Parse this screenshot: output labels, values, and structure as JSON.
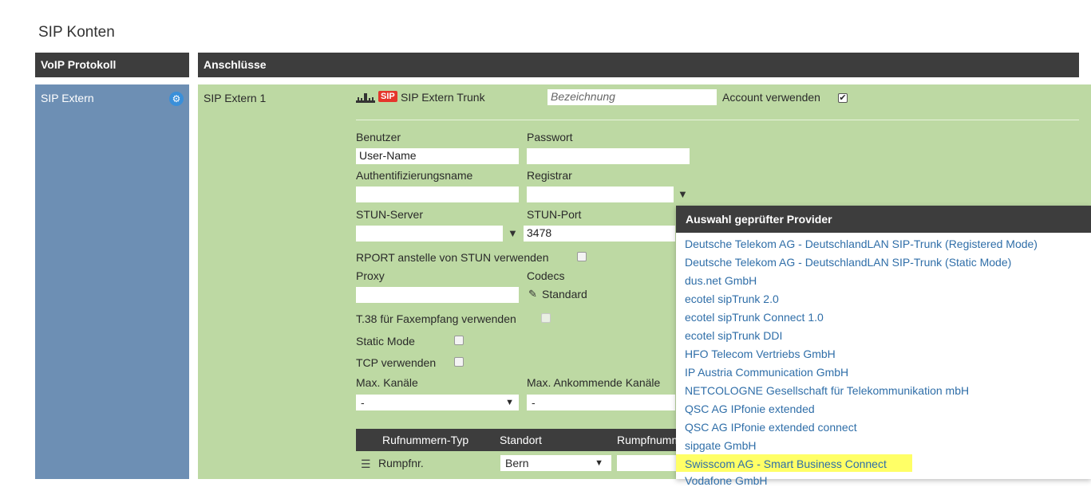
{
  "page_title": "SIP Konten",
  "headers": {
    "left": "VoIP Protokoll",
    "right": "Anschlüsse"
  },
  "left_item": "SIP Extern",
  "connection_name": "SIP Extern 1",
  "trunk": {
    "badge": "SIP",
    "title": "SIP Extern Trunk",
    "bezeichnung_placeholder": "Bezeichnung",
    "account_label": "Account verwenden",
    "account_checked": "✔"
  },
  "form": {
    "benutzer_label": "Benutzer",
    "benutzer_value": "User-Name",
    "passwort_label": "Passwort",
    "auth_label": "Authentifizierungsname",
    "registrar_label": "Registrar",
    "stun_server_label": "STUN-Server",
    "stun_port_label": "STUN-Port",
    "stun_port_value": "3478",
    "rport_label": "RPORT anstelle von STUN verwenden",
    "proxy_label": "Proxy",
    "codecs_label": "Codecs",
    "codecs_value": "Standard",
    "t38_label": "T.38 für Faxempfang verwenden",
    "static_label": "Static Mode",
    "tcp_label": "TCP verwenden",
    "max_kanaele_label": "Max. Kanäle",
    "max_kanaele_value": "-",
    "max_ankommende_label": "Max. Ankommende Kanäle",
    "max_ankommende_value": "-"
  },
  "table": {
    "col1": "Rufnummern-Typ",
    "col2": "Standort",
    "col3": "Rumpfnummer",
    "row_type": "Rumpfnr.",
    "row_location": "Bern"
  },
  "dropdown": {
    "title": "Auswahl geprüfter Provider",
    "items": [
      "Deutsche Telekom AG - DeutschlandLAN SIP-Trunk (Registered Mode)",
      "Deutsche Telekom AG - DeutschlandLAN SIP-Trunk (Static Mode)",
      "dus.net GmbH",
      "ecotel sipTrunk 2.0",
      "ecotel sipTrunk Connect 1.0",
      "ecotel sipTrunk DDI",
      "HFO Telecom Vertriebs GmbH",
      "IP Austria Communication GmbH",
      "NETCOLOGNE Gesellschaft für Telekommunikation mbH",
      "QSC AG IPfonie extended",
      "QSC AG IPfonie extended connect",
      "sipgate GmbH",
      "Swisscom AG - Smart Business Connect",
      "Vodafone GmbH"
    ],
    "highlighted": "Swisscom AG - Smart Business Connect"
  },
  "colors": {
    "header": "#3d3d3d",
    "left_panel": "#6d8fb4",
    "green_panel": "#bdd9a3",
    "link": "#2f6ea8",
    "highlight": "#ffff66",
    "sip_badge": "#e5352b"
  }
}
